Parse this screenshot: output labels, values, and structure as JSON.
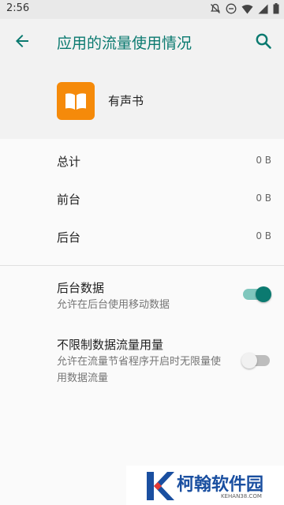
{
  "status": {
    "time": "2:56"
  },
  "appbar": {
    "title": "应用的流量使用情况"
  },
  "app": {
    "name": "有声书",
    "icon": "book-icon",
    "icon_color": "#f58a0a"
  },
  "usage": [
    {
      "label": "总计",
      "value": "0 B"
    },
    {
      "label": "前台",
      "value": "0 B"
    },
    {
      "label": "后台",
      "value": "0 B"
    }
  ],
  "settings": [
    {
      "title": "后台数据",
      "summary": "允许在后台使用移动数据",
      "enabled": true
    },
    {
      "title": "不限制数据流量用量",
      "summary": "允许在流量节省程序开启时无限量使用数据流量",
      "enabled": false
    }
  ],
  "watermark": {
    "text": "柯翰软件园",
    "sub": "KEHAN38.COM"
  },
  "colors": {
    "accent": "#0b7a70",
    "app_icon": "#f58a0a"
  }
}
